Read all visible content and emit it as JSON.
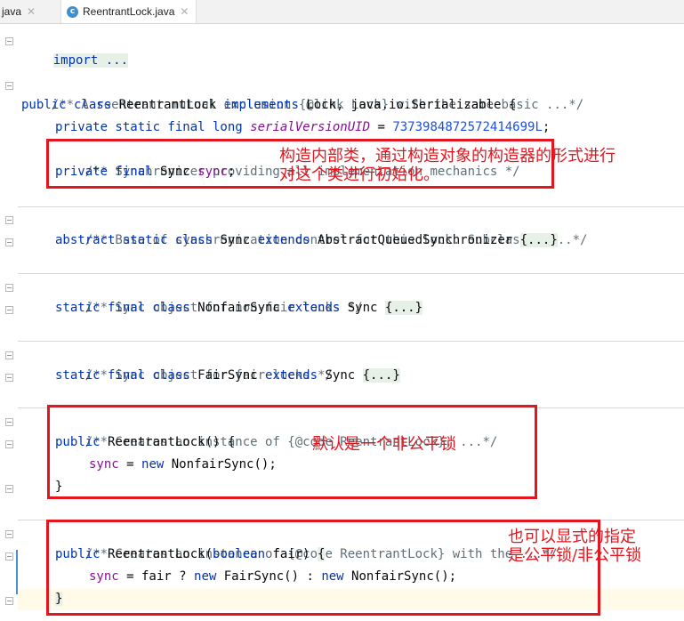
{
  "tabs": [
    {
      "label": "java"
    },
    {
      "label": "ReentrantLock.java",
      "icon": "class-icon"
    }
  ],
  "code": {
    "import": "import ...",
    "doc_class": "/** A reentrant mutual exclusion {@link Lock} with the same basic ...*/",
    "class_decl_kw": "public class",
    "class_decl_name": " ReentrantLock ",
    "class_decl_impl": "implements",
    "class_decl_rest": " Lock, java.io.Serializable {",
    "serial_kw": "private static final long ",
    "serial_name": "serialVersionUID",
    "serial_eq": " = ",
    "serial_val": "7373984872572414699L",
    "serial_end": ";",
    "doc_sync": "/** Synchronizer providing all implementation mechanics */",
    "sync_kw": "private final ",
    "sync_type": "Sync ",
    "sync_name": "sync",
    "sync_end": ";",
    "doc_base": "/** Base of synchronization control for this lock. Subclassed ...*/",
    "abs_kw": "abstract static class",
    "abs_name": " Sync ",
    "abs_ext": "extends",
    "abs_rest": " AbstractQueuedSynchronizer ",
    "abs_body": "{...}",
    "doc_nonfair": "/** Sync object for non-fair locks */",
    "nf_kw": "static final class",
    "nf_name": " NonfairSync ",
    "nf_ext": "extends",
    "nf_rest": " Sync ",
    "nf_body": "{...}",
    "doc_fair": "/** Sync object for fair locks */",
    "f_kw": "static final class",
    "f_name": " FairSync ",
    "f_ext": "extends",
    "f_rest": " Sync ",
    "f_body": "{...}",
    "doc_ctor1": "/** Creates an instance of {@code ReentrantLock}. ...*/",
    "ctor1_kw": "public",
    "ctor1_name": " ReentrantLock() {",
    "ctor1_field": "sync",
    "ctor1_eq": " = ",
    "ctor1_new": "new",
    "ctor1_rest": " NonfairSync();",
    "ctor1_close": "}",
    "doc_ctor2": "/** Creates an instance of {@code ReentrantLock} with the ...*/",
    "ctor2_kw": "public",
    "ctor2_name": " ReentrantLock(",
    "ctor2_bool": "boolean",
    "ctor2_param": " fair) ",
    "ctor2_brace": "{",
    "ctor2_field": "sync",
    "ctor2_eq": " = fair ? ",
    "ctor2_new1": "new",
    "ctor2_mid": " FairSync() : ",
    "ctor2_new2": "new",
    "ctor2_rest": " NonfairSync();",
    "ctor2_close": "}"
  },
  "annotations": {
    "box1_line1": "构造内部类，通过构造对象的构造器的形式进行",
    "box1_line2": "对这个类进行初始化。",
    "box2_line1": "默认是一个非公平锁",
    "box3_line1": "也可以显式的指定",
    "box3_line2": "是公平锁/非公平锁"
  },
  "colors": {
    "keyword": "#0033b3",
    "field": "#871094",
    "number": "#1750eb",
    "comment": "#5f6f78",
    "annotation_red": "#e3161f"
  }
}
